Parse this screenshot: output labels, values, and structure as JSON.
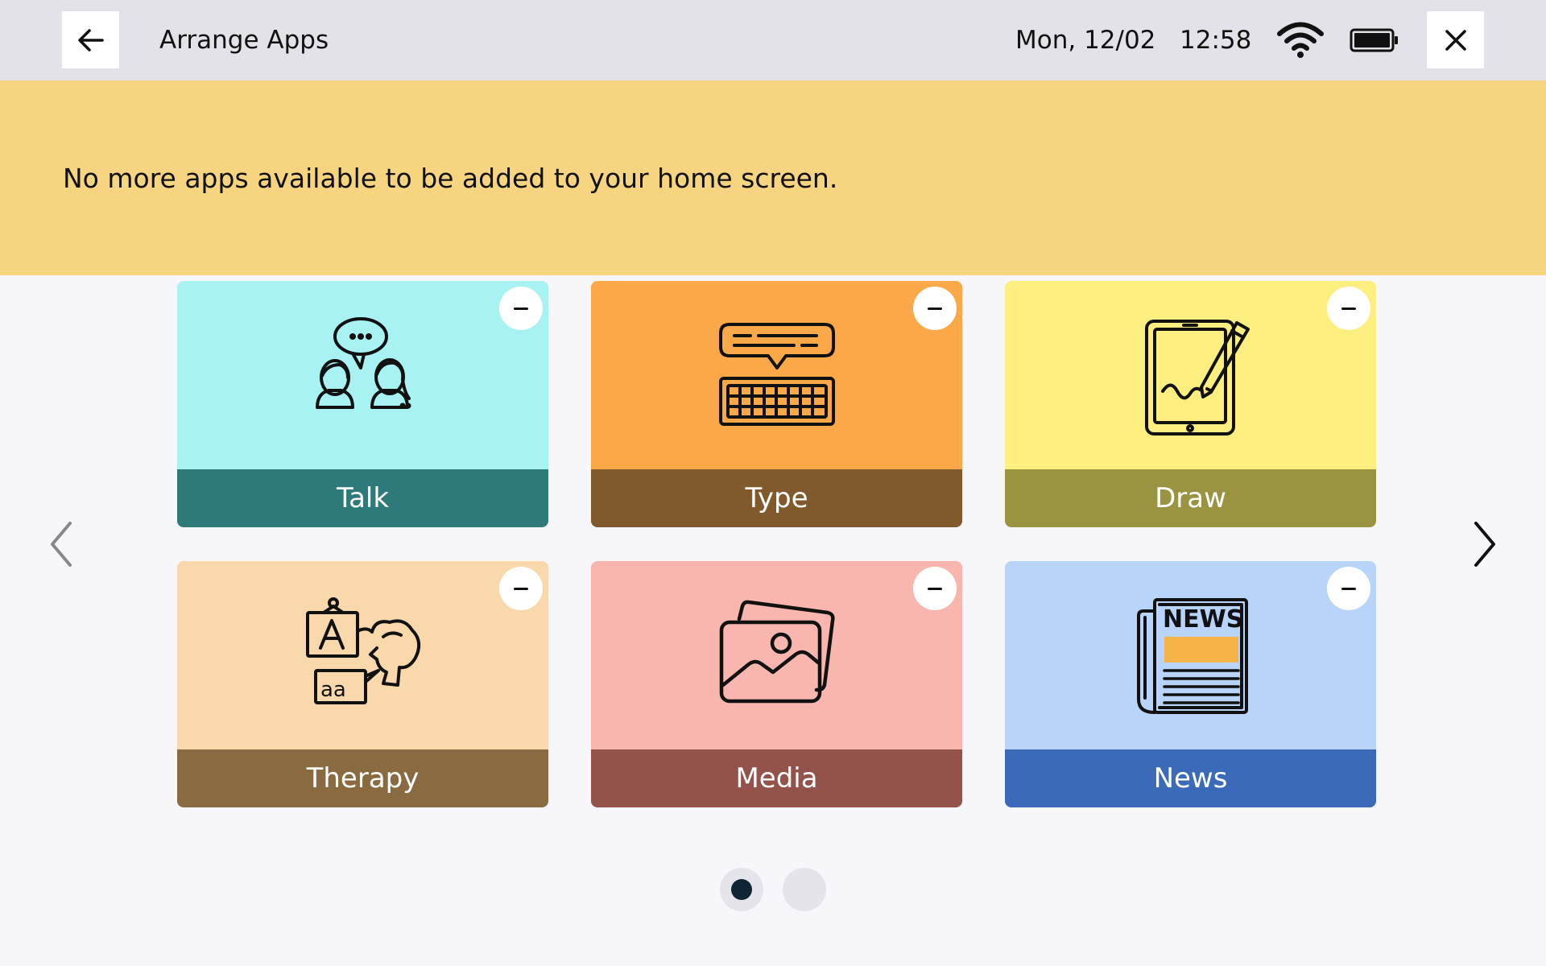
{
  "header": {
    "back_icon": "arrow-left-icon",
    "title": "Arrange Apps",
    "date": "Mon, 12/02",
    "time": "12:58",
    "wifi_icon": "wifi-icon",
    "battery_icon": "battery-icon",
    "close_icon": "close-icon",
    "bar_color": "#e2e2e8"
  },
  "banner": {
    "message": "No more apps available to be added to your home screen.",
    "color": "#f7d480"
  },
  "apps": [
    {
      "label": "Talk",
      "icon": "conversation-icon",
      "art_color": "#a8f2f4",
      "bar_color": "#2e7a7a"
    },
    {
      "label": "Type",
      "icon": "keyboard-icon",
      "art_color": "#fba848",
      "bar_color": "#805a2c"
    },
    {
      "label": "Draw",
      "icon": "tablet-pen-icon",
      "art_color": "#fcee7f",
      "bar_color": "#9a9442"
    },
    {
      "label": "Therapy",
      "icon": "speech-therapy-icon",
      "art_color": "#f9d8ac",
      "bar_color": "#8a6a40"
    },
    {
      "label": "Media",
      "icon": "photos-icon",
      "art_color": "#f8b6ae",
      "bar_color": "#93534a"
    },
    {
      "label": "News",
      "icon": "newspaper-icon",
      "art_color": "#b8d4fa",
      "bar_color": "#3a6ab8"
    }
  ],
  "navigation": {
    "prev_icon": "chevron-left-icon",
    "next_icon": "chevron-right-icon",
    "current_page": 1,
    "total_pages": 2
  }
}
